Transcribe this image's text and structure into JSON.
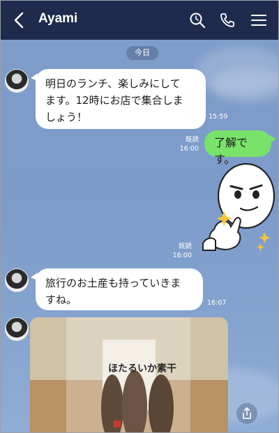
{
  "header": {
    "title": "Ayami",
    "background": "#1f2b4d"
  },
  "chat": {
    "date_divider": "今日",
    "messages": [
      {
        "sender": "Ayami",
        "type": "text",
        "text_lines": [
          "明日のランチ、楽しみにして",
          "ます。12時にお店で集合しま",
          "しょう！"
        ],
        "time": "15:59"
      },
      {
        "sender": "me",
        "type": "text",
        "text": "了解です。",
        "read": "既読",
        "time": "16:00"
      },
      {
        "sender": "me",
        "type": "sticker",
        "sticker": "smug-face-sticker",
        "read": "既読",
        "time": "16:00"
      },
      {
        "sender": "Ayami",
        "type": "text",
        "text_lines": [
          "旅行のお土産も持っていきま",
          "すね。"
        ],
        "time": "16:07"
      },
      {
        "sender": "Ayami",
        "type": "photo",
        "photo_label": "ほたるいか素干"
      }
    ]
  },
  "icons": {
    "back": "chevron-left-icon",
    "search": "search-icon",
    "call": "phone-icon",
    "menu": "hamburger-menu-icon",
    "share": "share-icon"
  },
  "colors": {
    "chat_bg": "#7f9dca",
    "my_bubble": "#79e26b",
    "their_bubble": "#ffffff"
  }
}
